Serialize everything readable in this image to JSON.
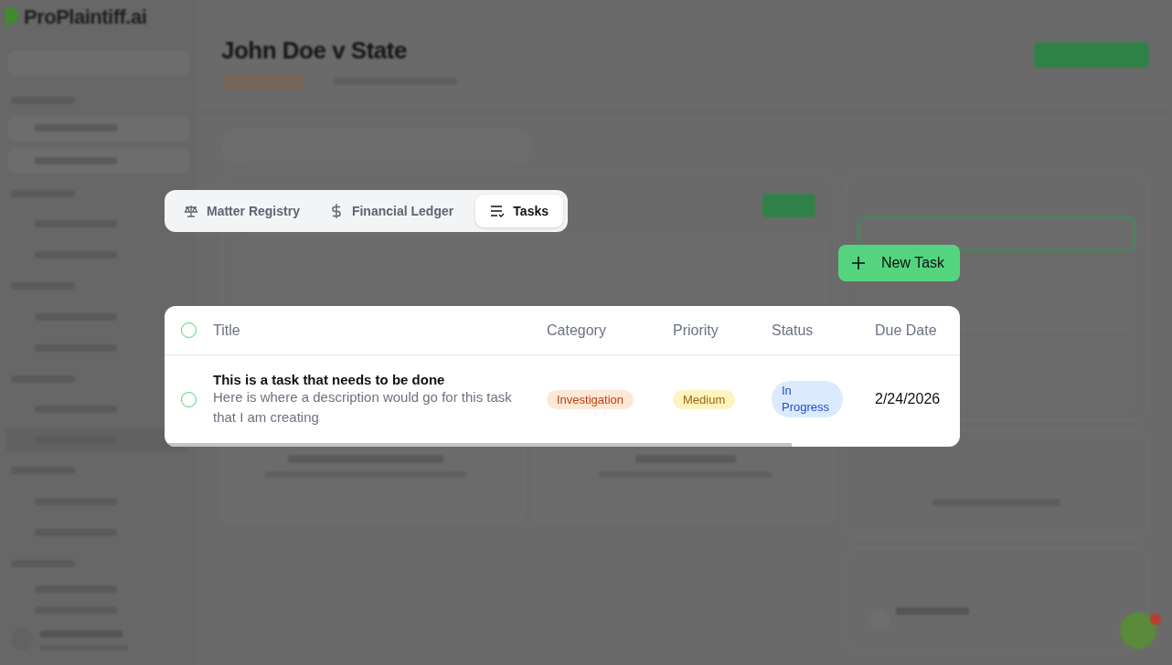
{
  "app": {
    "logo": "ProPlaintiff.ai"
  },
  "case": {
    "title": "John Doe v State"
  },
  "tabs": [
    {
      "label": "Matter Registry",
      "selected": false
    },
    {
      "label": "Financial Ledger",
      "selected": false
    },
    {
      "label": "Tasks",
      "selected": true
    }
  ],
  "new_task_button": {
    "label": "New Task"
  },
  "table": {
    "select_all": {
      "checked": false
    },
    "columns": [
      "Title",
      "Category",
      "Priority",
      "Status",
      "Due Date"
    ],
    "rows": [
      {
        "checked": false,
        "title": "This is a task that needs to be done",
        "description": "Here is where a description would go for this task that I am creating",
        "category": "Investigation",
        "priority": "Medium",
        "status": "In Progress",
        "due_date": "2/24/2026"
      }
    ]
  }
}
